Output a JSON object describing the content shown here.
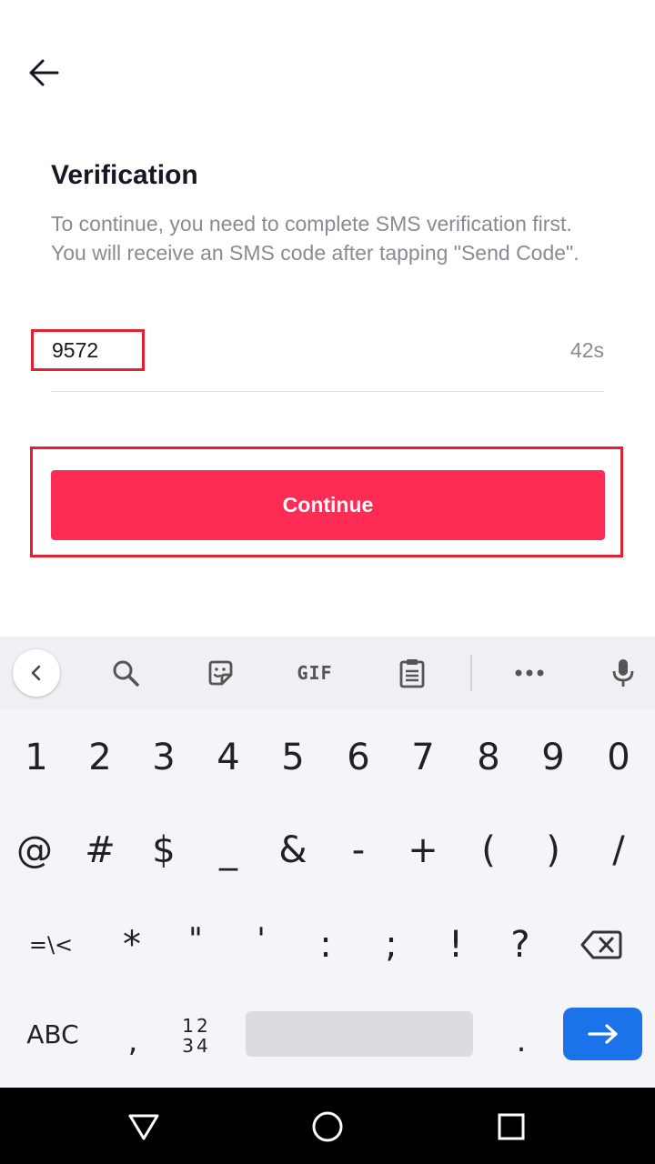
{
  "header": {
    "back_icon": "arrow-left-icon"
  },
  "verification": {
    "title": "Verification",
    "description": "To continue, you need to complete SMS verification first. You will receive an SMS code after tapping \"Send Code\".",
    "code_value": "9572",
    "timer": "42s",
    "continue_label": "Continue"
  },
  "colors": {
    "accent": "#fe2c55",
    "highlight": "#e5202e",
    "enter": "#1a73e8"
  },
  "keyboard": {
    "toolbar": {
      "icons": [
        "chevron-left-icon",
        "search-icon",
        "sticker-icon",
        "gif-icon",
        "clipboard-icon",
        "more-icon",
        "mic-icon"
      ],
      "gif_label": "GIF"
    },
    "row1": [
      "1",
      "2",
      "3",
      "4",
      "5",
      "6",
      "7",
      "8",
      "9",
      "0"
    ],
    "row2": [
      "@",
      "#",
      "$",
      "_",
      "&",
      "-",
      "+",
      "(",
      ")",
      "/"
    ],
    "row3": [
      "=\\<",
      "*",
      "\"",
      "'",
      ":",
      ";",
      "!",
      "?"
    ],
    "abc_label": "ABC",
    "comma": ",",
    "numpad_top": "12",
    "numpad_bottom": "34",
    "period": "."
  },
  "navbar": {
    "icons": [
      "back-triangle-icon",
      "home-circle-icon",
      "recents-square-icon"
    ]
  }
}
